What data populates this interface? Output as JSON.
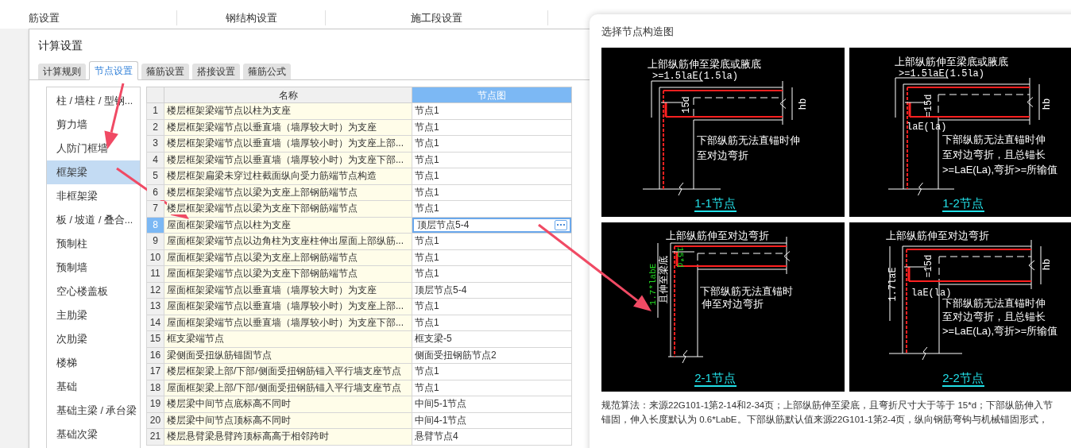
{
  "app_tabs": [
    "筋设置",
    "钢结构设置",
    "施工段设置"
  ],
  "dialog": {
    "title": "计算设置",
    "tabs": [
      {
        "label": "计算规则",
        "selected": false
      },
      {
        "label": "节点设置",
        "selected": true
      },
      {
        "label": "箍筋设置",
        "selected": false
      },
      {
        "label": "搭接设置",
        "selected": false
      },
      {
        "label": "箍筋公式",
        "selected": false
      }
    ],
    "categories": [
      {
        "label": "柱 / 墙柱 / 型钢...",
        "selected": false
      },
      {
        "label": "剪力墙",
        "selected": false
      },
      {
        "label": "人防门框墙",
        "selected": false
      },
      {
        "label": "框架梁",
        "selected": true
      },
      {
        "label": "非框架梁",
        "selected": false
      },
      {
        "label": "板 / 坡道 / 叠合...",
        "selected": false
      },
      {
        "label": "预制柱",
        "selected": false
      },
      {
        "label": "预制墙",
        "selected": false
      },
      {
        "label": "空心楼盖板",
        "selected": false
      },
      {
        "label": "主肋梁",
        "selected": false
      },
      {
        "label": "次肋梁",
        "selected": false
      },
      {
        "label": "楼梯",
        "selected": false
      },
      {
        "label": "基础",
        "selected": false
      },
      {
        "label": "基础主梁 / 承台梁",
        "selected": false
      },
      {
        "label": "基础次梁",
        "selected": false
      }
    ],
    "table": {
      "columns": [
        {
          "label": "名称",
          "selected": false
        },
        {
          "label": "节点图",
          "selected": true
        }
      ],
      "rows": [
        {
          "index": "1",
          "name": "楼层框架梁端节点以柱为支座",
          "node": "节点1",
          "selected": false
        },
        {
          "index": "2",
          "name": "楼层框架梁端节点以垂直墙（墙厚较大时）为支座",
          "node": "节点1",
          "selected": false
        },
        {
          "index": "3",
          "name": "楼层框架梁端节点以垂直墙（墙厚较小时）为支座上部...",
          "node": "节点1",
          "selected": false
        },
        {
          "index": "4",
          "name": "楼层框架梁端节点以垂直墙（墙厚较小时）为支座下部...",
          "node": "节点1",
          "selected": false
        },
        {
          "index": "5",
          "name": "楼层框架扁梁未穿过柱截面纵向受力筋端节点构造",
          "node": "节点1",
          "selected": false
        },
        {
          "index": "6",
          "name": "楼层框架梁端节点以梁为支座上部钢筋端节点",
          "node": "节点1",
          "selected": false
        },
        {
          "index": "7",
          "name": "楼层框架梁端节点以梁为支座下部钢筋端节点",
          "node": "节点1",
          "selected": false
        },
        {
          "index": "8",
          "name": "屋面框架梁端节点以柱为支座",
          "node": "顶层节点5-4",
          "selected": true
        },
        {
          "index": "9",
          "name": "屋面框架梁端节点以边角柱为支座柱伸出屋面上部纵筋...",
          "node": "节点1",
          "selected": false
        },
        {
          "index": "10",
          "name": "屋面框架梁端节点以梁为支座上部钢筋端节点",
          "node": "节点1",
          "selected": false
        },
        {
          "index": "11",
          "name": "屋面框架梁端节点以梁为支座下部钢筋端节点",
          "node": "节点1",
          "selected": false
        },
        {
          "index": "12",
          "name": "屋面框架梁端节点以垂直墙（墙厚较大时）为支座",
          "node": "顶层节点5-4",
          "selected": false
        },
        {
          "index": "13",
          "name": "屋面框架梁端节点以垂直墙（墙厚较小时）为支座上部...",
          "node": "节点1",
          "selected": false
        },
        {
          "index": "14",
          "name": "屋面框架梁端节点以垂直墙（墙厚较小时）为支座下部...",
          "node": "节点1",
          "selected": false
        },
        {
          "index": "15",
          "name": "框支梁端节点",
          "node": "框支梁-5",
          "selected": false
        },
        {
          "index": "16",
          "name": "梁侧面受扭纵筋锚固节点",
          "node": "侧面受扭钢筋节点2",
          "selected": false
        },
        {
          "index": "17",
          "name": "楼层框架梁上部/下部/侧面受扭钢筋锚入平行墙支座节点",
          "node": "节点1",
          "selected": false
        },
        {
          "index": "18",
          "name": "屋面框架梁上部/下部/侧面受扭钢筋锚入平行墙支座节点",
          "node": "节点1",
          "selected": false
        },
        {
          "index": "19",
          "name": "楼层梁中间节点底标高不同时",
          "node": "中间5-1节点",
          "selected": false
        },
        {
          "index": "20",
          "name": "楼层梁中间节点顶标高不同时",
          "node": "中间4-1节点",
          "selected": false
        },
        {
          "index": "21",
          "name": "楼层悬臂梁悬臂跨顶标高高于相邻跨时",
          "node": "悬臂节点4",
          "selected": false
        }
      ]
    }
  },
  "node_picker": {
    "title": "选择节点构造图",
    "options": [
      {
        "title": "1-1节点",
        "labels": [
          {
            "text": "上部纵筋伸至梁底或腋底",
            "kind": "text"
          },
          {
            "text": ">=1.5laE(1.5la)",
            "kind": "dim"
          },
          {
            "text": "15d",
            "kind": "vertical"
          },
          {
            "text": "hb",
            "kind": "vertical"
          },
          {
            "text": "下部纵筋无法直锚时伸",
            "kind": "text"
          },
          {
            "text": "至对边弯折",
            "kind": "text"
          }
        ]
      },
      {
        "title": "1-2节点",
        "labels": [
          {
            "text": "上部纵筋伸至梁底或腋底",
            "kind": "text"
          },
          {
            "text": ">=1.5laE(1.5la)",
            "kind": "dim"
          },
          {
            "text": "=15d",
            "kind": "vertical"
          },
          {
            "text": "hb",
            "kind": "vertical"
          },
          {
            "text": "laE(la)",
            "kind": "dim"
          },
          {
            "text": "下部纵筋无法直锚时伸",
            "kind": "text"
          },
          {
            "text": "至对边弯折，且总锚长",
            "kind": "text"
          },
          {
            "text": ">=LaE(La),弯折>=所输值",
            "kind": "text"
          }
        ]
      },
      {
        "title": "2-1节点",
        "labels": [
          {
            "text": "上部纵筋伸至对边弯折",
            "kind": "text"
          },
          {
            "text": "1.7*labE",
            "kind": "vertical-green"
          },
          {
            "text": "且伸至梁底",
            "kind": "vertical"
          },
          {
            "text": "15*d",
            "kind": "flipped-green"
          },
          {
            "text": "下部纵筋无法直锚时",
            "kind": "text"
          },
          {
            "text": "伸至对边弯折",
            "kind": "text"
          }
        ]
      },
      {
        "title": "2-2节点",
        "labels": [
          {
            "text": "上部纵筋伸至对边弯折",
            "kind": "text"
          },
          {
            "text": "1.7laE",
            "kind": "vertical"
          },
          {
            "text": "=15d",
            "kind": "vertical"
          },
          {
            "text": "hb",
            "kind": "vertical"
          },
          {
            "text": "laE(la)",
            "kind": "dim"
          },
          {
            "text": "下部纵筋无法直锚时伸",
            "kind": "text"
          },
          {
            "text": "至对边弯折，且总锚长",
            "kind": "text"
          },
          {
            "text": ">=LaE(La),弯折>=所输值",
            "kind": "text"
          }
        ]
      }
    ],
    "description": [
      "规范算法：来源22G101-1第2-14和2-34页；上部纵筋伸至梁底，且弯折尺寸大于等于 15*d；下部纵筋伸入节",
      "锚固，伸入长度默认为 0.6*LabE。下部纵筋默认值来源22G101-1第2-4页，纵向钢筋弯钩与机械锚固形式，"
    ]
  }
}
